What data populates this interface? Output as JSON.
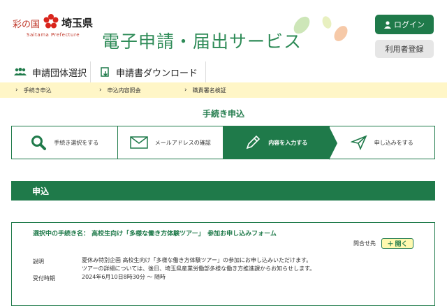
{
  "header": {
    "brand": "彩の国",
    "pref_name": "埼玉県",
    "pref_sub": "Saitama Prefecture",
    "service_title": "電子申請・届出サービス",
    "login_label": "ログイン",
    "register_label": "利用者登録"
  },
  "nav": {
    "items": [
      {
        "label": "申請団体選択"
      },
      {
        "label": "申請書ダウンロード"
      }
    ]
  },
  "subnav": {
    "items": [
      {
        "label": "手続き申込"
      },
      {
        "label": "申込内容照会"
      },
      {
        "label": "職責署名検証"
      }
    ]
  },
  "page_title": "手続き申込",
  "steps": [
    {
      "label": "手続き選択をする",
      "icon": "search-icon"
    },
    {
      "label": "メールアドレスの確認",
      "icon": "mail-icon"
    },
    {
      "label": "内容を入力する",
      "icon": "pen-icon"
    },
    {
      "label": "申し込みをする",
      "icon": "send-icon"
    }
  ],
  "section_title": "申込",
  "form": {
    "heading": "選択中の手続き名： 高校生向け「多様な働き方体験ツアー」　参加お申し込みフォーム",
    "contact_label": "問合せ先",
    "open_label": "開く",
    "description_label": "説明",
    "description_line1": "夏休み特別企画 高校生向け「多様な働き方体験ツアー」の参加にお申し込みいただけます。",
    "description_line2": "ツアーの詳細については、後日、埼玉県産業労働部多様な働き方推進課からお知らせします。",
    "period_label": "受付時期",
    "period_value": "2024年6月10日8時30分 〜 随時"
  },
  "colors": {
    "primary_green": "#1f7a4a",
    "title_green": "#2e8b57",
    "subnav_yellow": "#fff6c7",
    "open_button_yellow": "#fff9b0"
  }
}
